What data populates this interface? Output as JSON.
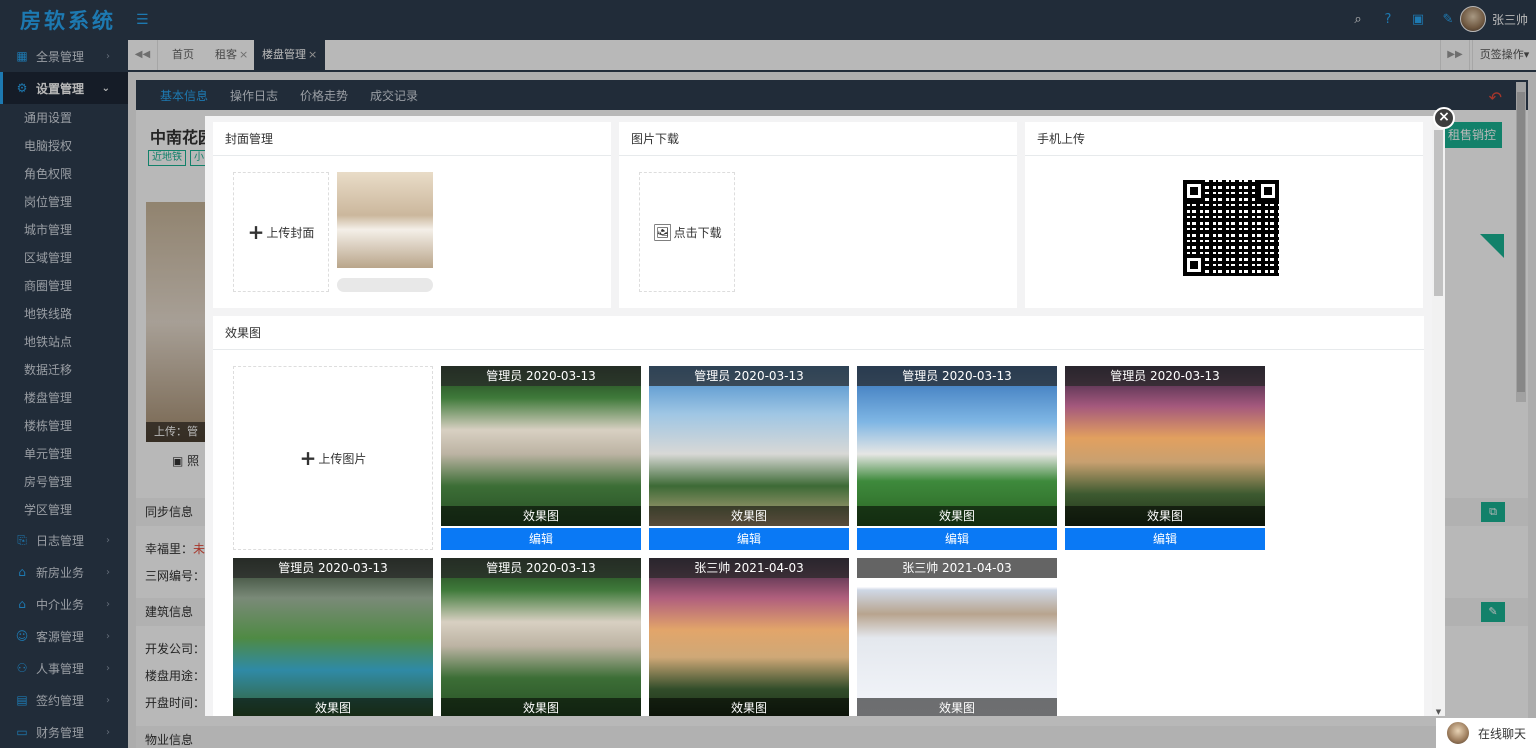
{
  "app": {
    "logo": "房软系统",
    "username": "张三帅"
  },
  "topbar": {
    "menu_icon": "hamburger-icon",
    "icons": [
      "search-icon",
      "help-icon",
      "calendar-icon",
      "edit-icon"
    ]
  },
  "sidebar": {
    "groups_top": [
      {
        "label": "全景管理",
        "icon": "panorama-icon"
      },
      {
        "label": "设置管理",
        "icon": "gear-icon",
        "active": true
      }
    ],
    "sub_items": [
      "通用设置",
      "电脑授权",
      "角色权限",
      "岗位管理",
      "城市管理",
      "区域管理",
      "商圈管理",
      "地铁线路",
      "地铁站点",
      "数据迁移",
      "楼盘管理",
      "楼栋管理",
      "单元管理",
      "房号管理",
      "学区管理"
    ],
    "groups_bottom": [
      {
        "label": "日志管理",
        "icon": "log-icon"
      },
      {
        "label": "新房业务",
        "icon": "house-icon"
      },
      {
        "label": "中介业务",
        "icon": "agency-icon"
      },
      {
        "label": "客源管理",
        "icon": "customer-icon"
      },
      {
        "label": "人事管理",
        "icon": "org-icon"
      },
      {
        "label": "签约管理",
        "icon": "contract-icon"
      },
      {
        "label": "财务管理",
        "icon": "wallet-icon"
      }
    ]
  },
  "tabs": {
    "items": [
      {
        "label": "首页",
        "closable": false
      },
      {
        "label": "租客",
        "closable": true
      },
      {
        "label": "楼盘管理",
        "closable": true,
        "active": true
      }
    ],
    "page_ops": "页签操作",
    "close_glyph": "×"
  },
  "page": {
    "subnav": [
      "基本信息",
      "操作日志",
      "价格走势",
      "成交记录"
    ],
    "building_title": "中南花园",
    "tags": [
      "近地铁",
      "小"
    ],
    "green_button": "租售销控",
    "photo_caption": "上传：管",
    "photo_link": "照",
    "sections": [
      {
        "label": "同步信息"
      },
      {
        "label": "建筑信息"
      },
      {
        "label": "物业信息"
      }
    ],
    "fields": [
      {
        "label": "幸福里：",
        "value": "未"
      },
      {
        "label": "三网编号：",
        "value": ""
      },
      {
        "label": "开发公司：",
        "value": ""
      },
      {
        "label": "楼盘用途：",
        "value": ""
      },
      {
        "label": "开盘时间：",
        "value": ""
      }
    ]
  },
  "modal": {
    "close_glyph": "×",
    "cover": {
      "title": "封面管理",
      "upload_label": "上传封面"
    },
    "download": {
      "title": "图片下载",
      "button_label": "点击下载"
    },
    "mobile": {
      "title": "手机上传"
    },
    "gallery": {
      "title": "效果图",
      "upload_label": "上传图片",
      "edit_label": "编辑",
      "cards": [
        {
          "uploader": "管理员 2020-03-13",
          "type": "效果图",
          "editable": true
        },
        {
          "uploader": "管理员 2020-03-13",
          "type": "效果图",
          "editable": true
        },
        {
          "uploader": "管理员 2020-03-13",
          "type": "效果图",
          "editable": true
        },
        {
          "uploader": "管理员 2020-03-13",
          "type": "效果图",
          "editable": true
        },
        {
          "uploader": "管理员 2020-03-13",
          "type": "效果图"
        },
        {
          "uploader": "管理员 2020-03-13",
          "type": "效果图"
        },
        {
          "uploader": "张三帅 2021-04-03",
          "type": "效果图"
        },
        {
          "uploader": "张三帅 2021-04-03",
          "type": "效果图"
        }
      ]
    }
  },
  "chat": {
    "label": "在线聊天"
  },
  "colors": {
    "sidebar_bg": "#2f3d4f",
    "accent": "#29a8f5",
    "green": "#1ab394",
    "edit_blue": "#0a79f5"
  }
}
